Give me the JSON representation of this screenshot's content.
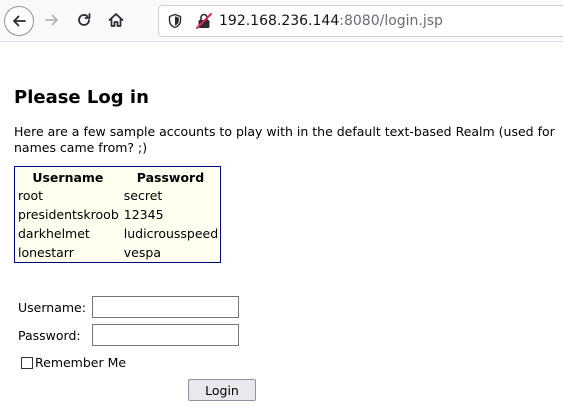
{
  "browser": {
    "url_host": "192.168.236.144",
    "url_rest": ":8080/login.jsp",
    "icons": [
      "back-arrow-icon",
      "forward-arrow-icon",
      "reload-icon",
      "home-icon",
      "shield-icon",
      "insecure-lock-icon"
    ]
  },
  "page": {
    "title": "Please Log in",
    "intro_line1": "Here are a few sample accounts to play with in the default text-based Realm (used for",
    "intro_line2": "names came from? ;)"
  },
  "accounts": {
    "headers": [
      "Username",
      "Password"
    ],
    "rows": [
      [
        "root",
        "secret"
      ],
      [
        "presidentskroob",
        "12345"
      ],
      [
        "darkhelmet",
        "ludicrousspeed"
      ],
      [
        "lonestarr",
        "vespa"
      ]
    ]
  },
  "form": {
    "username_label": "Username:",
    "username_value": "",
    "password_label": "Password:",
    "password_value": "",
    "remember_label": "Remember Me",
    "remember_checked": false,
    "submit_label": "Login"
  },
  "colors": {
    "table_border": "#000080",
    "table_background": "#fffff0"
  }
}
